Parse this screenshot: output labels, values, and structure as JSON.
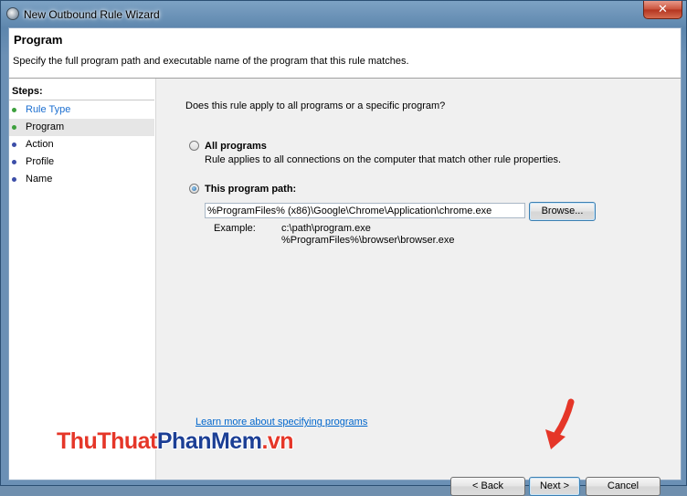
{
  "window": {
    "title": "New Outbound Rule Wizard",
    "close_glyph": "✕"
  },
  "header": {
    "title": "Program",
    "description": "Specify the full program path and executable name of the program that this rule matches."
  },
  "steps": {
    "label": "Steps:",
    "items": [
      {
        "label": "Rule Type",
        "color": "#1c6fd0",
        "bullet_color": "#3da03d"
      },
      {
        "label": "Program",
        "color": "#000000",
        "bullet_color": "#3da03d"
      },
      {
        "label": "Action",
        "color": "#000000",
        "bullet_color": "#3c4ea8"
      },
      {
        "label": "Profile",
        "color": "#000000",
        "bullet_color": "#3c4ea8"
      },
      {
        "label": "Name",
        "color": "#000000",
        "bullet_color": "#3c4ea8"
      }
    ],
    "active_index": 1
  },
  "main": {
    "question": "Does this rule apply to all programs or a specific program?",
    "all_programs": {
      "title": "All programs",
      "description": "Rule applies to all connections on the computer that match other rule properties.",
      "checked": false
    },
    "this_program": {
      "title": "This program path:",
      "checked": true,
      "path_value": "%ProgramFiles% (x86)\\Google\\Chrome\\Application\\chrome.exe",
      "browse_label": "Browse...",
      "example_label": "Example:",
      "example_line1": "c:\\path\\program.exe",
      "example_line2": "%ProgramFiles%\\browser\\browser.exe"
    },
    "learn_more": "Learn more about specifying programs"
  },
  "buttons": {
    "back": "< Back",
    "next": "Next >",
    "cancel": "Cancel"
  },
  "watermark": {
    "part1": "ThuThuat",
    "part2": "PhanMem",
    "part3": ".vn"
  },
  "colors": {
    "accent": "#1c6fd0",
    "link": "#0066cc",
    "arrow": "#e53628"
  }
}
